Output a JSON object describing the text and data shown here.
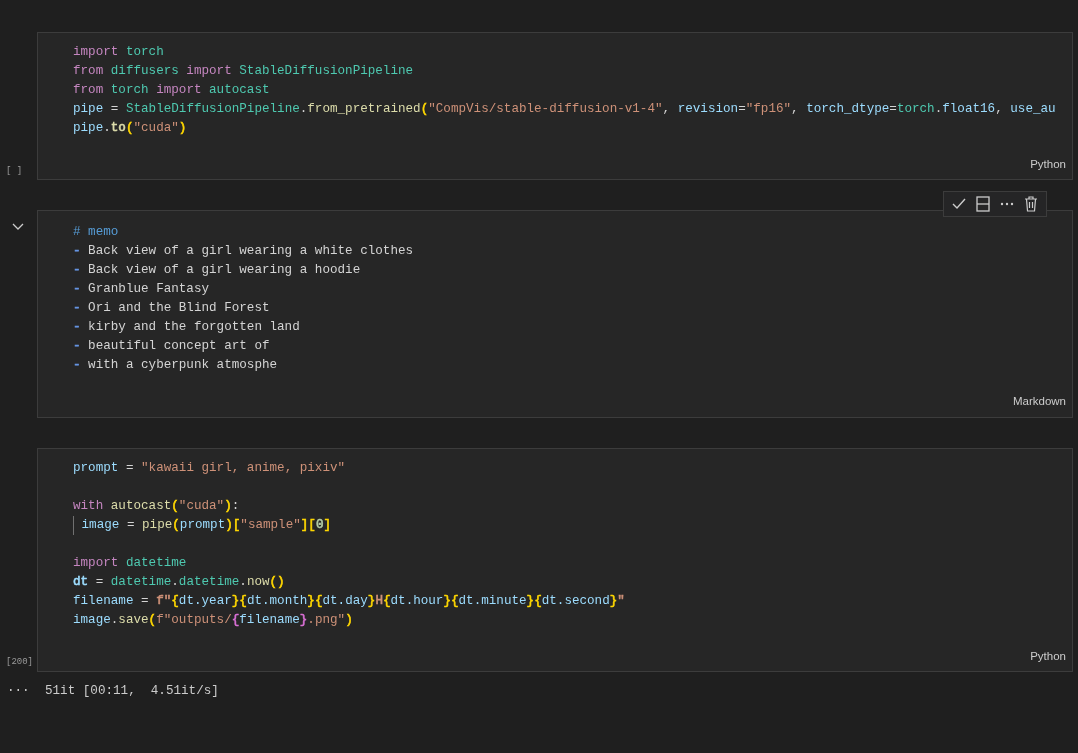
{
  "cells": [
    {
      "kind": "code",
      "exec_count": "[ ]",
      "language": "Python",
      "lines": [
        {
          "tokens": [
            {
              "text": "import",
              "color": "#c586c0"
            },
            {
              "text": " torch",
              "color": "#4ec9b0"
            }
          ]
        },
        {
          "tokens": [
            {
              "text": "from",
              "color": "#c586c0"
            },
            {
              "text": " diffusers",
              "color": "#4ec9b0"
            },
            {
              "text": " import",
              "color": "#c586c0"
            },
            {
              "text": " StableDiffusionPipeline",
              "color": "#4ec9b0"
            }
          ]
        },
        {
          "tokens": [
            {
              "text": "from",
              "color": "#c586c0"
            },
            {
              "text": " torch",
              "color": "#4ec9b0"
            },
            {
              "text": " import",
              "color": "#c586c0"
            },
            {
              "text": " autocast",
              "color": "#4ec9b0"
            }
          ]
        },
        {
          "tokens": [
            {
              "text": "pipe",
              "color": "#9cdcfe"
            },
            {
              "text": " = "
            },
            {
              "text": "StableDiffusionPipeline",
              "color": "#4ec9b0"
            },
            {
              "text": "."
            },
            {
              "text": "from_pretrained",
              "color": "#dcdcaa"
            },
            {
              "text": "(",
              "color": "#ffd700"
            },
            {
              "text": "\"CompVis/stable-diffusion-v1-4\"",
              "color": "#ce9178"
            },
            {
              "text": ", "
            },
            {
              "text": "revision",
              "color": "#9cdcfe"
            },
            {
              "text": "="
            },
            {
              "text": "\"fp16\"",
              "color": "#ce9178"
            },
            {
              "text": ", "
            },
            {
              "text": "torch_dtype",
              "color": "#9cdcfe"
            },
            {
              "text": "="
            },
            {
              "text": "torch",
              "color": "#4ec9b0"
            },
            {
              "text": "."
            },
            {
              "text": "float16",
              "color": "#9cdcfe"
            },
            {
              "text": ", "
            },
            {
              "text": "use_au",
              "color": "#9cdcfe"
            }
          ]
        },
        {
          "tokens": [
            {
              "text": "pipe",
              "color": "#9cdcfe"
            },
            {
              "text": "."
            },
            {
              "text": "to",
              "color": "#dcdcaa"
            },
            {
              "text": "(",
              "color": "#ffd700"
            },
            {
              "text": "\"cuda\"",
              "color": "#ce9178"
            },
            {
              "text": ")",
              "color": "#ffd700"
            }
          ]
        }
      ]
    },
    {
      "kind": "markdown",
      "language": "Markdown",
      "collapse_toggle": true,
      "toolbar": true,
      "lines": [
        {
          "tokens": [
            {
              "text": "# memo",
              "color": "#569cd6"
            }
          ]
        },
        {
          "tokens": [
            {
              "text": "-",
              "color": "#6796e6"
            },
            {
              "text": " Back view of a girl wearing a white clothes",
              "color": "#d4d4d4"
            }
          ]
        },
        {
          "tokens": [
            {
              "text": "-",
              "color": "#6796e6"
            },
            {
              "text": " Back view of a girl wearing a hoodie",
              "color": "#d4d4d4"
            }
          ]
        },
        {
          "tokens": [
            {
              "text": "-",
              "color": "#6796e6"
            },
            {
              "text": " Granblue Fantasy",
              "color": "#d4d4d4"
            }
          ]
        },
        {
          "tokens": [
            {
              "text": "-",
              "color": "#6796e6"
            },
            {
              "text": " Ori and the Blind Forest",
              "color": "#d4d4d4"
            }
          ]
        },
        {
          "tokens": [
            {
              "text": "-",
              "color": "#6796e6"
            },
            {
              "text": " kirby and the forgotten land",
              "color": "#d4d4d4"
            }
          ]
        },
        {
          "tokens": [
            {
              "text": "-",
              "color": "#6796e6"
            },
            {
              "text": " beautiful concept art of",
              "color": "#d4d4d4"
            }
          ]
        },
        {
          "tokens": [
            {
              "text": "-",
              "color": "#6796e6"
            },
            {
              "text": " with a cyberpunk atmosphe",
              "color": "#d4d4d4"
            }
          ]
        }
      ]
    },
    {
      "kind": "code",
      "exec_count": "[200]",
      "language": "Python",
      "lines": [
        {
          "tokens": [
            {
              "text": "prompt",
              "color": "#9cdcfe"
            },
            {
              "text": " = "
            },
            {
              "text": "\"kawaii girl, anime, pixiv\"",
              "color": "#ce9178"
            }
          ]
        },
        {
          "blank_line_before": true,
          "tokens": [
            {
              "text": "with",
              "color": "#c586c0"
            },
            {
              "text": " autocast",
              "color": "#dcdcaa"
            },
            {
              "text": "(",
              "color": "#ffd700"
            },
            {
              "text": "\"cuda\"",
              "color": "#ce9178"
            },
            {
              "text": ")",
              "color": "#ffd700"
            },
            {
              "text": ":"
            }
          ]
        },
        {
          "indent_guide": true,
          "tokens": [
            {
              "text": " image",
              "color": "#9cdcfe"
            },
            {
              "text": " = "
            },
            {
              "text": "pipe",
              "color": "#dcdcaa"
            },
            {
              "text": "(",
              "color": "#ffd700"
            },
            {
              "text": "prompt",
              "color": "#9cdcfe"
            },
            {
              "text": ")[",
              "color": "#ffd700"
            },
            {
              "text": "\"sample\"",
              "color": "#ce9178"
            },
            {
              "text": "][",
              "color": "#ffd700"
            },
            {
              "text": "0",
              "color": "#b5cea8"
            },
            {
              "text": "]",
              "color": "#ffd700"
            }
          ]
        },
        {
          "blank_line_before": true,
          "tokens": [
            {
              "text": "import",
              "color": "#c586c0"
            },
            {
              "text": " datetime",
              "color": "#4ec9b0"
            }
          ]
        },
        {
          "tokens": [
            {
              "text": "dt",
              "color": "#9cdcfe"
            },
            {
              "text": " = "
            },
            {
              "text": "datetime",
              "color": "#4ec9b0"
            },
            {
              "text": "."
            },
            {
              "text": "datetime",
              "color": "#4ec9b0"
            },
            {
              "text": "."
            },
            {
              "text": "now",
              "color": "#dcdcaa"
            },
            {
              "text": "()",
              "color": "#ffd700"
            }
          ]
        },
        {
          "tokens": [
            {
              "text": "filename",
              "color": "#9cdcfe"
            },
            {
              "text": " = "
            },
            {
              "text": "f\"",
              "color": "#ce9178"
            },
            {
              "text": "{",
              "color": "#ffd700"
            },
            {
              "text": "dt.year",
              "color": "#9cdcfe"
            },
            {
              "text": "}{",
              "color": "#ffd700"
            },
            {
              "text": "dt.month",
              "color": "#9cdcfe"
            },
            {
              "text": "}{",
              "color": "#ffd700"
            },
            {
              "text": "dt.day",
              "color": "#9cdcfe"
            },
            {
              "text": "}",
              "color": "#ffd700"
            },
            {
              "text": "H",
              "color": "#ce9178"
            },
            {
              "text": "{",
              "color": "#ffd700"
            },
            {
              "text": "dt.hour",
              "color": "#9cdcfe"
            },
            {
              "text": "}{",
              "color": "#ffd700"
            },
            {
              "text": "dt.minute",
              "color": "#9cdcfe"
            },
            {
              "text": "}{",
              "color": "#ffd700"
            },
            {
              "text": "dt.second",
              "color": "#9cdcfe"
            },
            {
              "text": "}",
              "color": "#ffd700"
            },
            {
              "text": "\"",
              "color": "#ce9178"
            }
          ]
        },
        {
          "tokens": [
            {
              "text": "image",
              "color": "#9cdcfe"
            },
            {
              "text": "."
            },
            {
              "text": "save",
              "color": "#dcdcaa"
            },
            {
              "text": "(",
              "color": "#ffd700"
            },
            {
              "text": "f\"outputs/",
              "color": "#ce9178"
            },
            {
              "text": "{",
              "color": "#da70d6"
            },
            {
              "text": "filename",
              "color": "#9cdcfe"
            },
            {
              "text": "}",
              "color": "#da70d6"
            },
            {
              "text": ".png\"",
              "color": "#ce9178"
            },
            {
              "text": ")",
              "color": "#ffd700"
            }
          ]
        }
      ]
    }
  ],
  "output": {
    "more": "···",
    "text": "51it [00:11,  4.51it/s]"
  }
}
